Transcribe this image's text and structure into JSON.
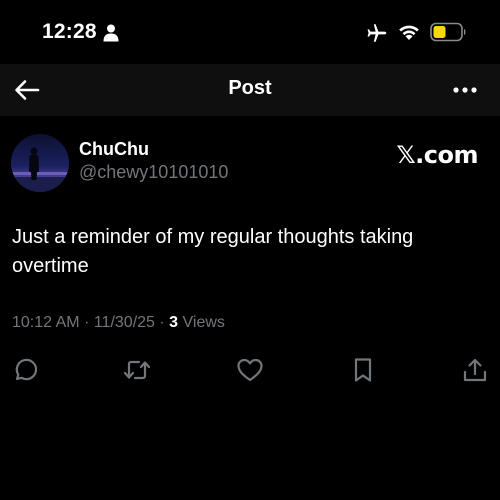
{
  "status_bar": {
    "time": "12:28",
    "icons": [
      "person-icon",
      "airplane-icon",
      "wifi-icon",
      "battery-icon"
    ],
    "battery_color": "#f5d90a"
  },
  "header": {
    "title": "Post",
    "back_icon": "back-arrow-icon",
    "more_icon": "more-dots-icon"
  },
  "post": {
    "author": {
      "name": "ChuChu",
      "handle": "@chewy10101010",
      "avatar_icon": "avatar-image"
    },
    "source_badge": "𝕏.com",
    "text": "Just a reminder of my regular thoughts taking overtime",
    "meta": {
      "time": "10:12 AM",
      "separator": "·",
      "date": "11/30/25",
      "views_count": "3",
      "views_label": "Views"
    },
    "actions": [
      {
        "name": "reply",
        "icon": "reply-icon"
      },
      {
        "name": "repost",
        "icon": "repost-icon"
      },
      {
        "name": "like",
        "icon": "like-icon"
      },
      {
        "name": "bookmark",
        "icon": "bookmark-icon"
      },
      {
        "name": "share",
        "icon": "share-icon"
      }
    ]
  },
  "colors": {
    "background": "#000000",
    "header_background": "#0f0f0f",
    "text_primary": "#ffffff",
    "text_secondary": "#71767b"
  }
}
